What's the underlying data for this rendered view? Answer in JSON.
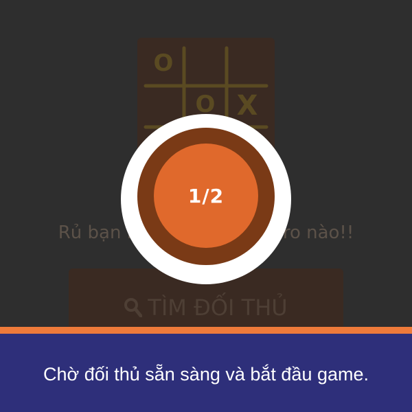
{
  "app": {
    "invite_text": "Rủ bạn bè vào chơi cờ caro nào!!",
    "find_button_label": "TÌM ĐỐI THỦ",
    "board_marks": [
      "O",
      "O",
      "X"
    ]
  },
  "overlay": {
    "counter": "1/2",
    "ready_players": 1,
    "total_players": 2
  },
  "banner": {
    "text": "Chờ đối thủ sẵn sàng và bắt đầu game."
  },
  "colors": {
    "background": "#2e2e2e",
    "accent_orange": "#e0692c",
    "ring_brown": "#7a3a16",
    "banner_navy": "#2e2f7a",
    "accent_line": "#ee7a3a"
  }
}
